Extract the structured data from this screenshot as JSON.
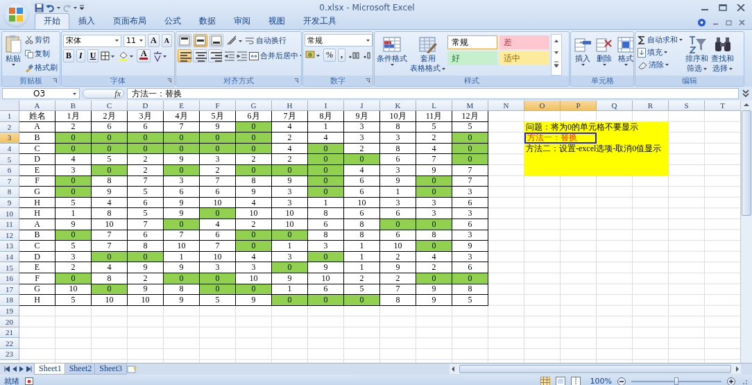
{
  "window": {
    "title": "0.xlsx - Microsoft Excel"
  },
  "tabs": [
    {
      "label": "开始",
      "selected": true
    },
    {
      "label": "插入",
      "selected": false
    },
    {
      "label": "页面布局",
      "selected": false
    },
    {
      "label": "公式",
      "selected": false
    },
    {
      "label": "数据",
      "selected": false
    },
    {
      "label": "审阅",
      "selected": false
    },
    {
      "label": "视图",
      "selected": false
    },
    {
      "label": "开发工具",
      "selected": false
    }
  ],
  "ribbon": {
    "groups": [
      {
        "kind": "clipboard",
        "label": "剪贴板",
        "paste": "粘贴",
        "items": [
          "剪切",
          "复制",
          "格式刷"
        ]
      },
      {
        "kind": "font",
        "label": "字体",
        "font": "宋体",
        "size": "11",
        "grow": "A",
        "shrink": "A",
        "bold": "B",
        "italic": "I",
        "underline": "U",
        "font_color": "A"
      },
      {
        "kind": "alignment",
        "label": "对齐方式",
        "wrap": "自动换行",
        "merge": "合并后居中",
        "vertical_align": [
          {
            "selected": false
          },
          {
            "selected": true
          },
          {
            "selected": false
          }
        ],
        "horizontal_align": [
          {
            "selected": true
          },
          {
            "selected": false
          },
          {
            "selected": false
          }
        ]
      },
      {
        "kind": "number",
        "label": "数字",
        "format": "常规",
        "percent": "%",
        "comma": ","
      },
      {
        "kind": "styles",
        "label": "样式",
        "conditional": "条件格式",
        "table": [
          "套用",
          "表格格式"
        ],
        "cells": [
          {
            "text": "常规",
            "kind": "normal"
          },
          {
            "text": "差",
            "kind": "bad"
          },
          {
            "text": "好",
            "kind": "good"
          },
          {
            "text": "适中",
            "kind": "neutral"
          }
        ]
      },
      {
        "kind": "cells",
        "label": "单元格",
        "buttons": [
          "插入",
          "删除",
          "格式"
        ]
      },
      {
        "kind": "editing",
        "label": "编辑",
        "sum": "自动求和",
        "fill": "填充",
        "clear": "清除",
        "sort": [
          "排序和",
          "筛选"
        ],
        "find": [
          "查找和",
          "选择"
        ]
      }
    ]
  },
  "formula_bar": {
    "name_box": "O3",
    "function_button": "fx",
    "formula": "方法一：替换"
  },
  "sheet": {
    "columns": [
      {
        "label": "A",
        "selected": false
      },
      {
        "label": "B",
        "selected": false
      },
      {
        "label": "C",
        "selected": false
      },
      {
        "label": "D",
        "selected": false
      },
      {
        "label": "E",
        "selected": false
      },
      {
        "label": "F",
        "selected": false
      },
      {
        "label": "G",
        "selected": false
      },
      {
        "label": "H",
        "selected": false
      },
      {
        "label": "I",
        "selected": false
      },
      {
        "label": "J",
        "selected": false
      },
      {
        "label": "K",
        "selected": false
      },
      {
        "label": "L",
        "selected": false
      },
      {
        "label": "M",
        "selected": false
      },
      {
        "label": "N",
        "selected": false
      },
      {
        "label": "O",
        "selected": true
      },
      {
        "label": "P",
        "selected": true
      },
      {
        "label": "Q",
        "selected": false
      },
      {
        "label": "R",
        "selected": false
      },
      {
        "label": "S",
        "selected": false
      },
      {
        "label": "T",
        "selected": false
      }
    ],
    "row_numbers": [
      {
        "label": "1",
        "selected": false
      },
      {
        "label": "2",
        "selected": false
      },
      {
        "label": "3",
        "selected": true
      },
      {
        "label": "4",
        "selected": false
      },
      {
        "label": "5",
        "selected": false
      },
      {
        "label": "6",
        "selected": false
      },
      {
        "label": "7",
        "selected": false
      },
      {
        "label": "8",
        "selected": false
      },
      {
        "label": "9",
        "selected": false
      },
      {
        "label": "10",
        "selected": false
      },
      {
        "label": "11",
        "selected": false
      },
      {
        "label": "12",
        "selected": false
      },
      {
        "label": "13",
        "selected": false
      },
      {
        "label": "14",
        "selected": false
      },
      {
        "label": "15",
        "selected": false
      },
      {
        "label": "16",
        "selected": false
      },
      {
        "label": "17",
        "selected": false
      },
      {
        "label": "18",
        "selected": false
      },
      {
        "label": "19",
        "selected": false
      },
      {
        "label": "20",
        "selected": false
      },
      {
        "label": "21",
        "selected": false
      },
      {
        "label": "22",
        "selected": false
      },
      {
        "label": "23",
        "selected": false
      }
    ],
    "rows": [
      {
        "cells": [
          "姓名",
          "1月",
          "2月",
          "3月",
          "4月",
          "5月",
          "6月",
          "7月",
          "8月",
          "9月",
          "10月",
          "11月",
          "12月"
        ],
        "highlighted": [
          false,
          false,
          false,
          false,
          false,
          false,
          false,
          false,
          false,
          false,
          false,
          false,
          false
        ]
      },
      {
        "cells": [
          "A",
          "2",
          "6",
          "6",
          "7",
          "9",
          "0",
          "4",
          "1",
          "3",
          "8",
          "5",
          "5"
        ],
        "highlighted": [
          false,
          false,
          false,
          false,
          false,
          false,
          true,
          false,
          false,
          false,
          false,
          false,
          false
        ]
      },
      {
        "cells": [
          "B",
          "0",
          "0",
          "0",
          "0",
          "0",
          "0",
          "2",
          "4",
          "3",
          "3",
          "2",
          "0"
        ],
        "highlighted": [
          false,
          true,
          true,
          true,
          true,
          true,
          true,
          false,
          false,
          false,
          false,
          false,
          true
        ]
      },
      {
        "cells": [
          "C",
          "0",
          "0",
          "0",
          "0",
          "0",
          "0",
          "4",
          "0",
          "2",
          "8",
          "4",
          "0"
        ],
        "highlighted": [
          false,
          true,
          true,
          true,
          true,
          true,
          true,
          false,
          true,
          false,
          false,
          false,
          true
        ]
      },
      {
        "cells": [
          "D",
          "4",
          "5",
          "2",
          "9",
          "3",
          "2",
          "2",
          "0",
          "0",
          "6",
          "7",
          "0"
        ],
        "highlighted": [
          false,
          false,
          false,
          false,
          false,
          false,
          false,
          false,
          true,
          true,
          false,
          false,
          true
        ]
      },
      {
        "cells": [
          "E",
          "3",
          "0",
          "2",
          "0",
          "2",
          "0",
          "0",
          "0",
          "4",
          "3",
          "9",
          "7"
        ],
        "highlighted": [
          false,
          false,
          true,
          false,
          true,
          false,
          true,
          true,
          true,
          false,
          false,
          false,
          false
        ]
      },
      {
        "cells": [
          "F",
          "0",
          "8",
          "7",
          "3",
          "7",
          "8",
          "9",
          "0",
          "6",
          "9",
          "0",
          "7"
        ],
        "highlighted": [
          false,
          true,
          false,
          false,
          false,
          false,
          false,
          false,
          true,
          false,
          false,
          true,
          false
        ]
      },
      {
        "cells": [
          "G",
          "0",
          "9",
          "5",
          "6",
          "6",
          "9",
          "3",
          "0",
          "6",
          "1",
          "0",
          "3"
        ],
        "highlighted": [
          false,
          true,
          false,
          false,
          false,
          false,
          false,
          false,
          true,
          false,
          false,
          true,
          false
        ]
      },
      {
        "cells": [
          "H",
          "5",
          "4",
          "6",
          "9",
          "10",
          "4",
          "3",
          "1",
          "10",
          "3",
          "3",
          "6"
        ],
        "highlighted": [
          false,
          false,
          false,
          false,
          false,
          false,
          false,
          false,
          false,
          false,
          false,
          false,
          false
        ]
      },
      {
        "cells": [
          "H",
          "1",
          "8",
          "5",
          "9",
          "0",
          "10",
          "10",
          "8",
          "6",
          "6",
          "3",
          "3"
        ],
        "highlighted": [
          false,
          false,
          false,
          false,
          false,
          true,
          false,
          false,
          false,
          false,
          false,
          false,
          false
        ]
      },
      {
        "cells": [
          "A",
          "9",
          "10",
          "7",
          "0",
          "4",
          "2",
          "10",
          "6",
          "8",
          "0",
          "0",
          "6"
        ],
        "highlighted": [
          false,
          false,
          false,
          false,
          true,
          false,
          false,
          false,
          false,
          false,
          true,
          true,
          false
        ]
      },
      {
        "cells": [
          "B",
          "0",
          "7",
          "6",
          "7",
          "6",
          "0",
          "0",
          "8",
          "8",
          "6",
          "8",
          "3"
        ],
        "highlighted": [
          false,
          true,
          false,
          false,
          false,
          false,
          true,
          true,
          false,
          false,
          false,
          false,
          false
        ]
      },
      {
        "cells": [
          "C",
          "5",
          "7",
          "8",
          "10",
          "7",
          "0",
          "1",
          "3",
          "1",
          "10",
          "0",
          "9"
        ],
        "highlighted": [
          false,
          false,
          false,
          false,
          false,
          false,
          true,
          false,
          false,
          false,
          false,
          true,
          false
        ]
      },
      {
        "cells": [
          "D",
          "3",
          "0",
          "0",
          "1",
          "10",
          "4",
          "3",
          "0",
          "1",
          "2",
          "4",
          "3"
        ],
        "highlighted": [
          false,
          false,
          true,
          true,
          false,
          false,
          false,
          false,
          true,
          false,
          false,
          false,
          false
        ]
      },
      {
        "cells": [
          "E",
          "2",
          "4",
          "9",
          "9",
          "3",
          "3",
          "0",
          "9",
          "1",
          "9",
          "2",
          "6"
        ],
        "highlighted": [
          false,
          false,
          false,
          false,
          false,
          false,
          false,
          true,
          false,
          false,
          false,
          false,
          false
        ]
      },
      {
        "cells": [
          "F",
          "0",
          "8",
          "2",
          "0",
          "0",
          "10",
          "9",
          "10",
          "2",
          "2",
          "0",
          "0"
        ],
        "highlighted": [
          false,
          true,
          false,
          false,
          true,
          true,
          false,
          false,
          false,
          false,
          false,
          true,
          true
        ]
      },
      {
        "cells": [
          "G",
          "10",
          "0",
          "9",
          "8",
          "0",
          "0",
          "1",
          "6",
          "5",
          "7",
          "9",
          "8"
        ],
        "highlighted": [
          false,
          false,
          true,
          false,
          false,
          true,
          true,
          false,
          false,
          false,
          false,
          false,
          false
        ]
      },
      {
        "cells": [
          "H",
          "5",
          "10",
          "10",
          "9",
          "5",
          "9",
          "0",
          "0",
          "0",
          "8",
          "9",
          "5"
        ],
        "highlighted": [
          false,
          false,
          false,
          false,
          false,
          false,
          false,
          true,
          true,
          true,
          false,
          false,
          false
        ]
      }
    ],
    "note": {
      "lines": [
        {
          "text": "问题：将为0的单元格不要显示",
          "kind": "plain",
          "selected": false
        },
        {
          "text": "方法一：替换",
          "kind": "accent",
          "selected": true
        },
        {
          "text": "方法二：设置-excel选项-取消0值显示",
          "kind": "plain",
          "selected": false
        }
      ]
    }
  },
  "sheet_tabs": [
    {
      "label": "Sheet1",
      "selected": true
    },
    {
      "label": "Sheet2",
      "selected": false
    },
    {
      "label": "Sheet3",
      "selected": false
    }
  ],
  "status_bar": {
    "status": "就绪",
    "zoom": {
      "text": "100%",
      "level": 0.5
    }
  }
}
